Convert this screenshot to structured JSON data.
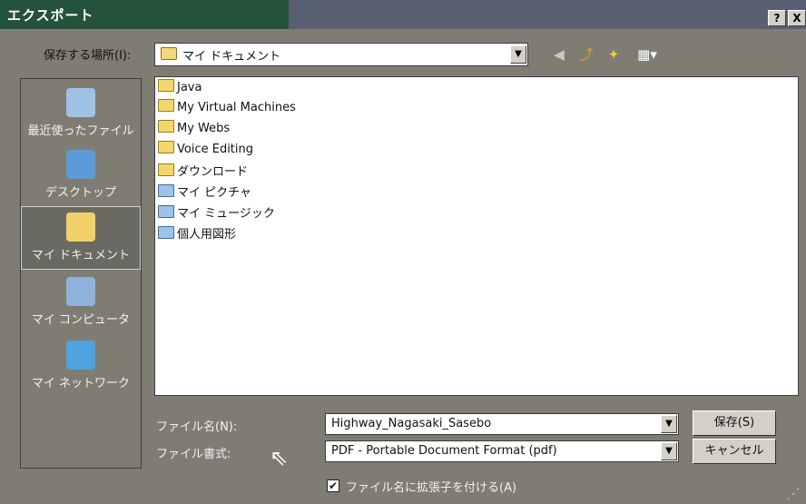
{
  "window": {
    "title": "エクスポート",
    "help_label": "?",
    "close_label": "X"
  },
  "save_in": {
    "label": "保存する場所(I):",
    "value": "マイ ドキュメント"
  },
  "toolbar": {
    "back_icon": "back-arrow-icon",
    "up_icon": "up-folder-icon",
    "new_folder_icon": "new-folder-icon",
    "views_icon": "views-menu-icon"
  },
  "places": [
    {
      "label": "最近使ったファイル",
      "icon": "recent-documents-icon"
    },
    {
      "label": "デスクトップ",
      "icon": "desktop-icon"
    },
    {
      "label": "マイ ドキュメント",
      "icon": "my-documents-icon",
      "active": true
    },
    {
      "label": "マイ コンピュータ",
      "icon": "my-computer-icon"
    },
    {
      "label": "マイ ネットワーク",
      "icon": "my-network-icon"
    }
  ],
  "files": [
    {
      "name": "Java",
      "type": "folder"
    },
    {
      "name": "My Virtual Machines",
      "type": "folder"
    },
    {
      "name": "My Webs",
      "type": "folder"
    },
    {
      "name": "Voice Editing",
      "type": "folder"
    },
    {
      "name": "ダウンロード",
      "type": "folder"
    },
    {
      "name": "マイ ピクチャ",
      "type": "special-folder"
    },
    {
      "name": "マイ ミュージック",
      "type": "special-folder"
    },
    {
      "name": "個人用図形",
      "type": "special-folder"
    }
  ],
  "filename": {
    "label": "ファイル名(N):",
    "value": "Highway_Nagasaki_Sasebo"
  },
  "format": {
    "label": "ファイル書式:",
    "value": "PDF - Portable Document Format (pdf)"
  },
  "buttons": {
    "save": "保存(S)",
    "cancel": "キャンセル"
  },
  "extension": {
    "label": "ファイル名に拡張子を付ける(A)",
    "checked": true
  },
  "colors": {
    "title_bar": "#5a5f74",
    "title_accent": "#24523a",
    "background": "#7f7d73"
  }
}
